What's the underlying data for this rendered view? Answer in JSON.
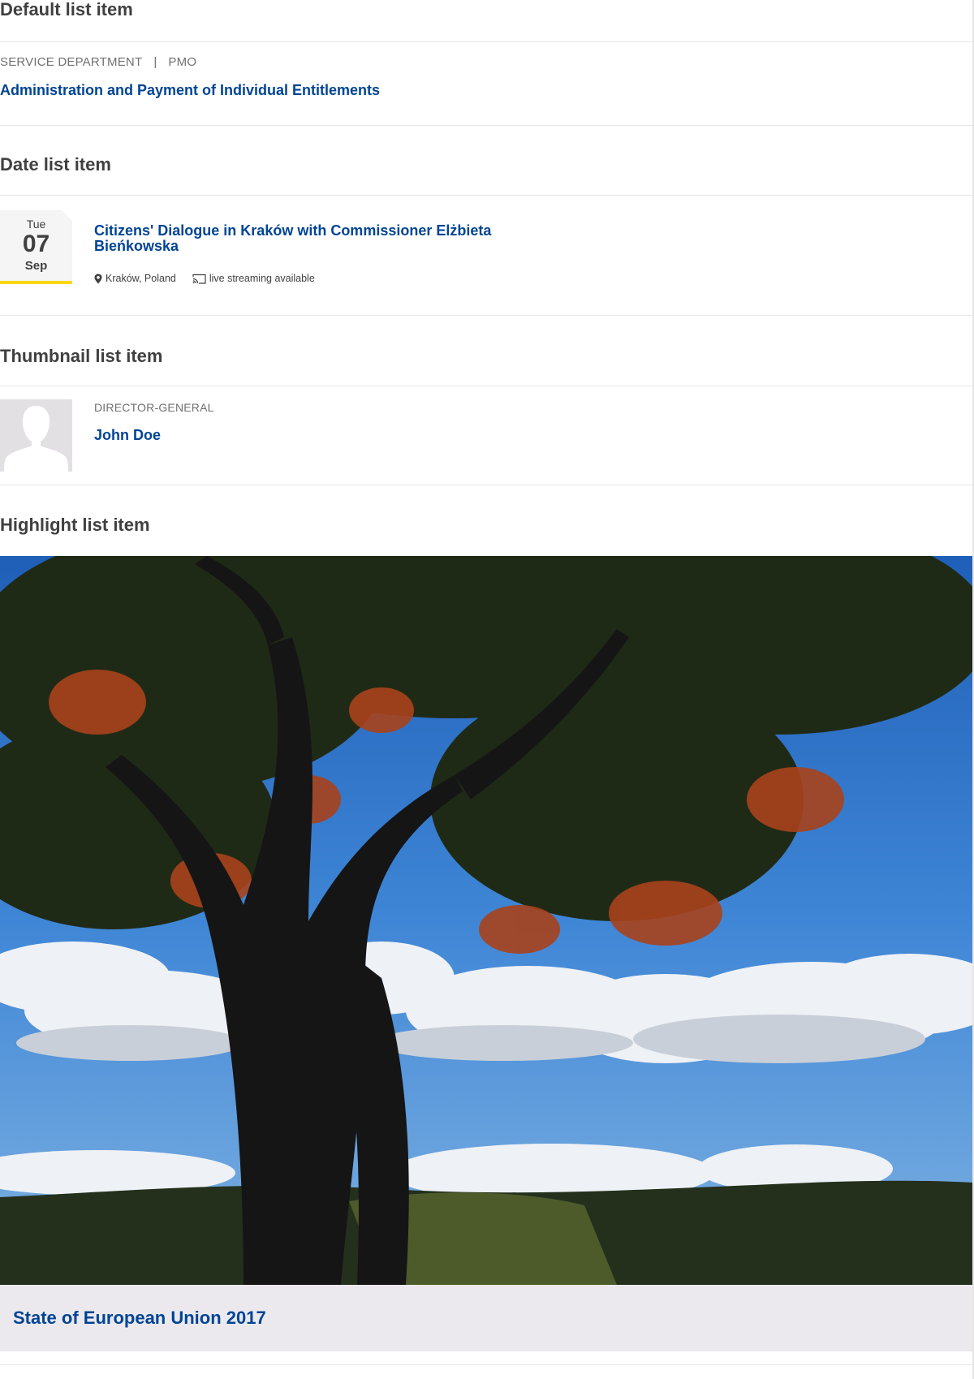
{
  "default_item": {
    "heading": "Default list item",
    "meta_left": "SERVICE DEPARTMENT",
    "meta_sep": "|",
    "meta_right": "PMO",
    "title": "Administration and Payment of Individual Entitlements"
  },
  "date_item": {
    "heading": "Date list item",
    "date": {
      "weekday": "Tue",
      "day": "07",
      "month": "Sep"
    },
    "title_line1": "Citizens' Dialogue in Kraków with Commissioner Elżbieta",
    "title_line2": "Bieńkowska",
    "location": "Kraków, Poland",
    "streaming": "live streaming available",
    "icons": [
      "map-marker-icon",
      "livestream-icon"
    ],
    "accent_color": "#ffd617"
  },
  "thumbnail_item": {
    "heading": "Thumbnail list item",
    "role": "DIRECTOR-GENERAL",
    "name": "John Doe",
    "icons": [
      "person-placeholder-icon"
    ]
  },
  "highlight_item": {
    "heading": "Highlight list item",
    "title": "State of European Union 2017"
  },
  "colors": {
    "link": "#004494",
    "heading": "#404040",
    "meta": "#707070",
    "caption_bg": "#ebe9ee"
  }
}
